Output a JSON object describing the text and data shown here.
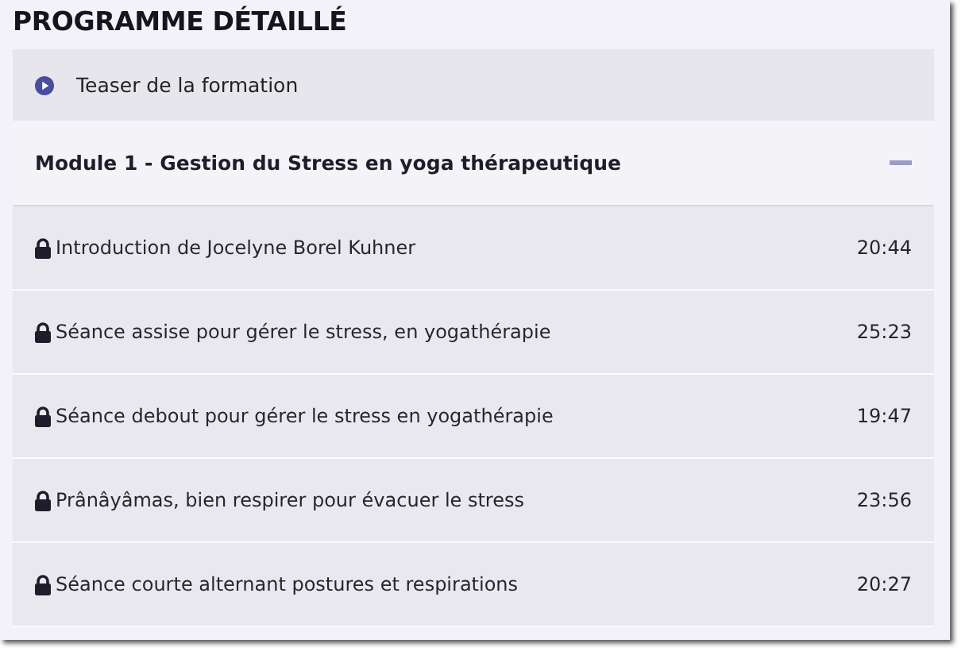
{
  "title": "PROGRAMME DÉTAILLÉ",
  "teaser": {
    "label": "Teaser de la formation"
  },
  "modules": [
    {
      "title": "Module 1 - Gestion du Stress en yoga thérapeutique",
      "expanded": true,
      "lessons": [
        {
          "title": "Introduction de Jocelyne Borel Kuhner",
          "duration": "20:44",
          "locked": true
        },
        {
          "title": "Séance assise pour gérer le stress, en yogathérapie",
          "duration": "25:23",
          "locked": true
        },
        {
          "title": "Séance debout pour gérer le stress en yogathérapie",
          "duration": "19:47",
          "locked": true
        },
        {
          "title": "Prânâyâmas, bien respirer pour évacuer le stress",
          "duration": "23:56",
          "locked": true
        },
        {
          "title": "Séance courte alternant postures et respirations",
          "duration": "20:27",
          "locked": true
        }
      ]
    }
  ]
}
